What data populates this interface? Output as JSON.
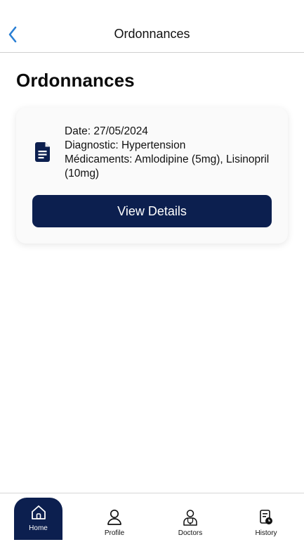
{
  "header": {
    "title": "Ordonnances",
    "back_icon": "chevron-left-icon"
  },
  "page": {
    "title": "Ordonnances"
  },
  "prescription": {
    "icon": "document-icon",
    "date": "Date: 27/05/2024",
    "diagnostic": "Diagnostic: Hypertension",
    "medications": "Médicaments: Amlodipine (5mg), Lisinopril (10mg)",
    "button_label": "View Details"
  },
  "tabs": [
    {
      "label": "Home",
      "icon": "home-icon",
      "active": true
    },
    {
      "label": "Profile",
      "icon": "person-icon",
      "active": false
    },
    {
      "label": "Doctors",
      "icon": "doctor-icon",
      "active": false
    },
    {
      "label": "History",
      "icon": "history-icon",
      "active": false
    }
  ],
  "colors": {
    "accent": "#0c1f4f",
    "back_arrow": "#2a7fd4"
  }
}
